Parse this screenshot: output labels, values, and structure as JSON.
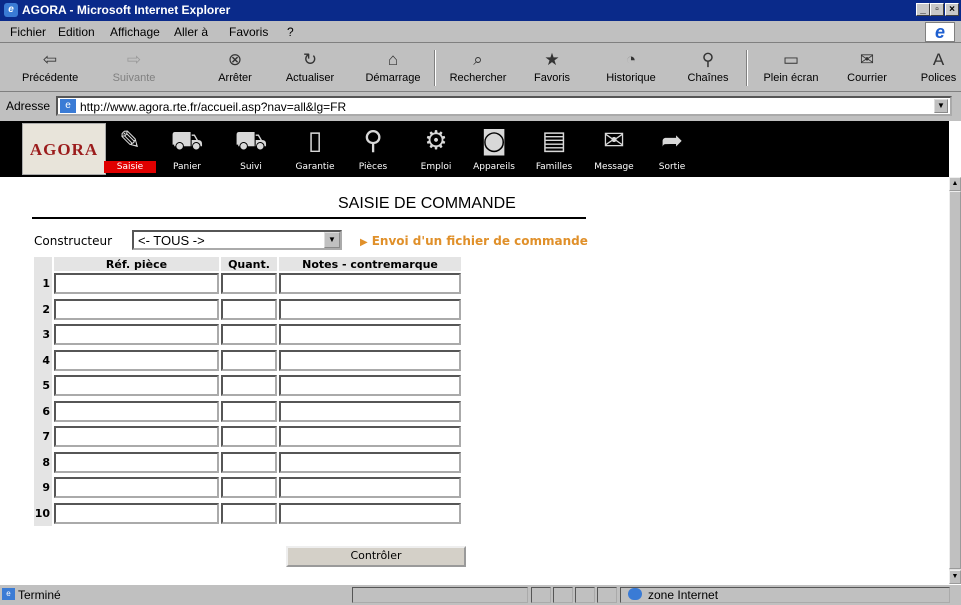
{
  "window": {
    "title": "AGORA - Microsoft Internet Explorer"
  },
  "menu": [
    "Fichier",
    "Edition",
    "Affichage",
    "Aller à",
    "Favoris",
    "?"
  ],
  "toolbar": [
    {
      "label": "Précédente",
      "icon": "back-arrow-icon",
      "enabled": true
    },
    {
      "label": "Suivante",
      "icon": "forward-arrow-icon",
      "enabled": false
    },
    {
      "label": "Arrêter",
      "icon": "stop-icon",
      "enabled": true
    },
    {
      "label": "Actualiser",
      "icon": "refresh-icon",
      "enabled": true
    },
    {
      "label": "Démarrage",
      "icon": "home-icon",
      "enabled": true
    },
    {
      "label": "Rechercher",
      "icon": "search-icon",
      "enabled": true
    },
    {
      "label": "Favoris",
      "icon": "favorites-icon",
      "enabled": true
    },
    {
      "label": "Historique",
      "icon": "history-icon",
      "enabled": true
    },
    {
      "label": "Chaînes",
      "icon": "channels-icon",
      "enabled": true
    },
    {
      "label": "Plein écran",
      "icon": "fullscreen-icon",
      "enabled": true
    },
    {
      "label": "Courrier",
      "icon": "mail-icon",
      "enabled": true
    },
    {
      "label": "Polices",
      "icon": "fonts-icon",
      "enabled": true
    }
  ],
  "address": {
    "label": "Adresse",
    "url": "http://www.agora.rte.fr/accueil.asp?nav=all&lg=FR"
  },
  "site_nav": {
    "logo": "AGORA",
    "items": [
      {
        "label": "Saisie",
        "icon": "pen-icon",
        "active": true
      },
      {
        "label": "Panier",
        "icon": "cart-icon",
        "active": false
      },
      {
        "label": "Suivi",
        "icon": "truck-icon",
        "active": false
      },
      {
        "label": "Garantie",
        "icon": "document-icon",
        "active": false
      },
      {
        "label": "Pièces",
        "icon": "magnifier-icon",
        "active": false
      },
      {
        "label": "Emploi",
        "icon": "gear-icon",
        "active": false
      },
      {
        "label": "Appareils",
        "icon": "washing-machine-icon",
        "active": false
      },
      {
        "label": "Familles",
        "icon": "folder-icon",
        "active": false
      },
      {
        "label": "Message",
        "icon": "envelope-icon",
        "active": false
      },
      {
        "label": "Sortie",
        "icon": "exit-icon",
        "active": false
      }
    ]
  },
  "form": {
    "title": "SAISIE DE COMMANDE",
    "constructeur_label": "Constructeur",
    "constructeur_value": "<- TOUS ->",
    "envoi_link": "Envoi d'un fichier de commande",
    "columns": [
      "Réf. pièce",
      "Quant.",
      "Notes - contremarque"
    ],
    "rows": [
      "1",
      "2",
      "3",
      "4",
      "5",
      "6",
      "7",
      "8",
      "9",
      "10"
    ],
    "submit_label": "Contrôler"
  },
  "status": {
    "text": "Terminé",
    "zone": "zone Internet"
  },
  "colors": {
    "titlebar": "#0a2a8a",
    "chrome": "#c0c0c0",
    "nav_bg": "#000000",
    "active_tab": "#e00000",
    "link": "#e0902a"
  }
}
